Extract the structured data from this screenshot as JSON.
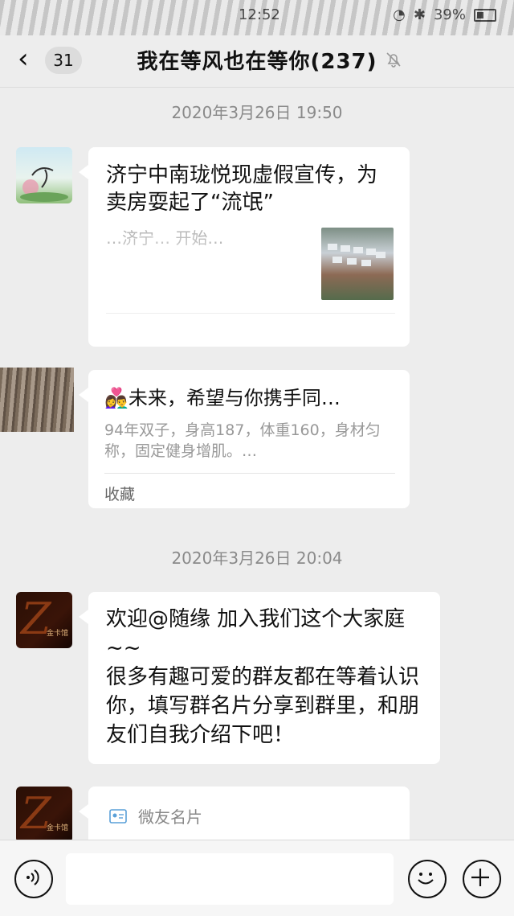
{
  "status_bar": {
    "time": "12:52",
    "battery": "39%"
  },
  "nav": {
    "back_count": "31",
    "title": "我在等风也在等你(237)"
  },
  "messages": [
    {
      "timestamp": "2020年3月26日 19:50"
    },
    {
      "type": "link",
      "title": "济宁中南珑悦现虚假宣传，为卖房耍起了“流氓”",
      "desc": "…济宁…\n开始…"
    },
    {
      "type": "favorite",
      "emoji": "👩‍❤️‍👨",
      "title": "未来，希望与你携手同…",
      "desc": "94年双子，身高187，体重160，身材匀称，固定健身增肌。…",
      "footer": "收藏"
    },
    {
      "timestamp": "2020年3月26日 20:04"
    },
    {
      "type": "text",
      "avatar_label": "金卡馆",
      "text": "欢迎@随缘 加入我们这个大家庭~~\n很多有趣可爱的群友都在等着认识你，填写群名片分享到群里，和朋友们自我介绍下吧！"
    },
    {
      "type": "card",
      "avatar_label": "金卡馆",
      "label": "微友名片"
    }
  ],
  "icons": {
    "back": "chevron-left-icon",
    "mute": "bell-off-icon",
    "voice": "voice-icon",
    "emoji": "smile-icon",
    "plus": "plus-icon"
  },
  "colors": {
    "background": "#ededed",
    "bubble": "#ffffff",
    "timestamp": "#8a8a8a"
  }
}
